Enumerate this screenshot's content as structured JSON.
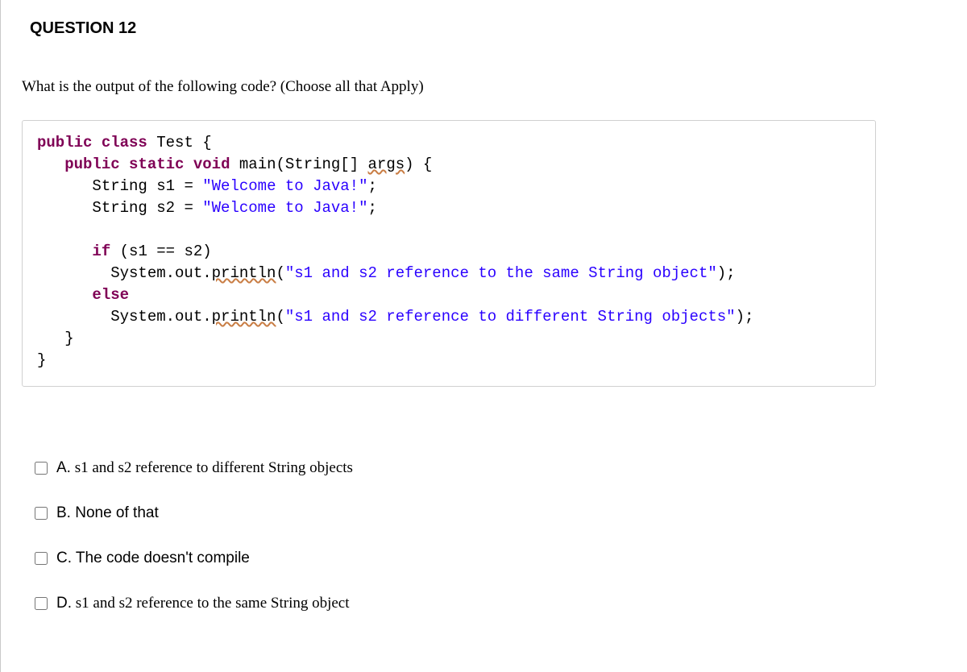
{
  "question": {
    "number_label": "QUESTION 12",
    "prompt": "What is the output of the following code? (Choose all that Apply)"
  },
  "code": {
    "l1": {
      "kw1": "public",
      "kw2": "class",
      "name": "Test",
      "open": " {"
    },
    "l2": {
      "indent": "   ",
      "kw1": "public",
      "kw2": "static",
      "kw3": "void",
      "method": " main(String[] ",
      "arg": "args",
      "close": ") {"
    },
    "l3": {
      "indent": "      ",
      "decl": "String s1 = ",
      "str": "\"Welcome to Java!\"",
      "semi": ";"
    },
    "l4": {
      "indent": "      ",
      "decl": "String s2 = ",
      "str": "\"Welcome to Java!\"",
      "semi": ";"
    },
    "blank1": " ",
    "l5": {
      "indent": "      ",
      "kw": "if",
      "cond": " (s1 == s2)"
    },
    "l6": {
      "indent": "        ",
      "call1": "System.out.",
      "pr": "println",
      "open": "(",
      "str": "\"s1 and s2 reference to the same String object\"",
      "close": ");"
    },
    "l7": {
      "indent": "      ",
      "kw": "else"
    },
    "l8": {
      "indent": "        ",
      "call1": "System.out.",
      "pr": "println",
      "open": "(",
      "str": "\"s1 and s2 reference to different String objects\"",
      "close": ");"
    },
    "l9": {
      "indent": "   ",
      "brace": "}"
    },
    "l10": {
      "indent": "",
      "brace": "}"
    }
  },
  "answers": [
    {
      "letter": "A.",
      "text": " s1 and s2 reference to different String objects",
      "serif": true
    },
    {
      "letter": "B.",
      "text": " None of that",
      "serif": false
    },
    {
      "letter": "C.",
      "text": " The code doesn't compile",
      "serif": false
    },
    {
      "letter": "D.",
      "text": " s1 and s2 reference to the same String object",
      "serif": true
    }
  ]
}
